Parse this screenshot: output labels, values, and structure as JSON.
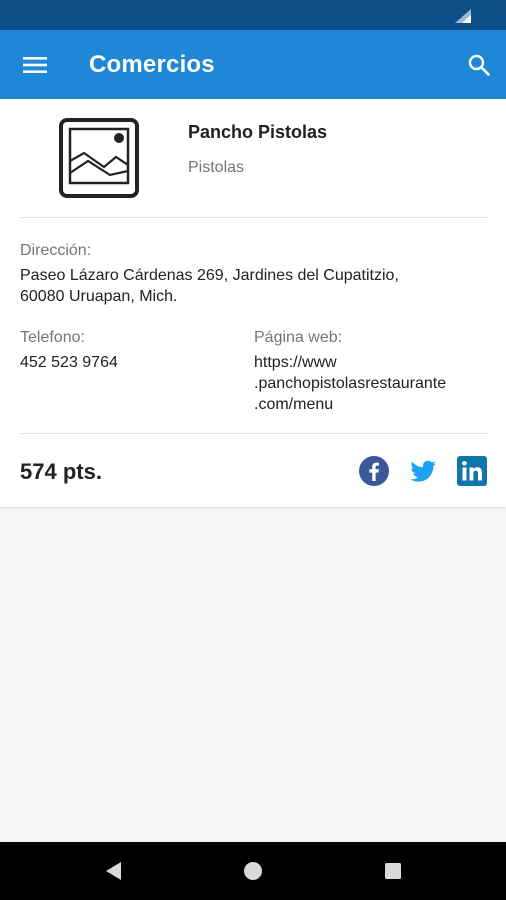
{
  "status_bar": {
    "signal_icon": "cell-signal-icon"
  },
  "app_bar": {
    "title": "Comercios",
    "menu_icon": "menu-icon",
    "search_icon": "search-icon",
    "color": "#1e88d6"
  },
  "business": {
    "name": "Pancho Pistolas",
    "category": "Pistolas",
    "image_icon": "image-placeholder-icon",
    "address_label": "Dirección:",
    "address_line1": "Paseo Lázaro Cárdenas 269, Jardines del Cupatitzio,",
    "address_line2": "60080 Uruapan, Mich.",
    "phone_label": "Telefono:",
    "phone": "452 523 9764",
    "web_label": "Página web:",
    "web_line1": "https://www",
    "web_line2": ".panchopistolasrestaurante",
    "web_line3": ".com/menu",
    "points": "574 pts."
  },
  "social": {
    "facebook_color": "#3b5998",
    "twitter_color": "#1da1f2",
    "linkedin_color": "#0e76a8"
  },
  "nav_bar": {
    "back_icon": "back-icon",
    "home_icon": "home-icon",
    "recents_icon": "recents-icon"
  }
}
